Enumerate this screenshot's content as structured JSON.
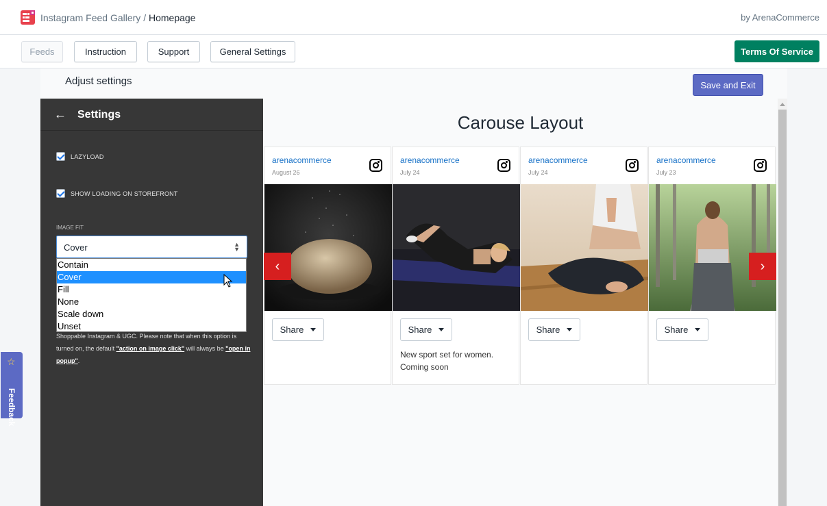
{
  "header": {
    "app_name": "Instagram Feed Gallery",
    "separator": "/",
    "page": "Homepage",
    "byline": "by ArenaCommerce"
  },
  "nav": {
    "feeds": "Feeds",
    "instruction": "Instruction",
    "support": "Support",
    "general_settings": "General Settings",
    "terms": "Terms Of Service"
  },
  "main": {
    "adjust_title": "Adjust settings",
    "save_exit": "Save and Exit"
  },
  "settings": {
    "back_icon": "arrow-left-icon",
    "title": "Settings",
    "lazyload": "LAZYLOAD",
    "lazyload_checked": true,
    "show_loading": "SHOW LOADING ON STOREFRONT",
    "show_loading_checked": true,
    "image_fit_label": "IMAGE FIT",
    "image_fit_value": "Cover",
    "image_fit_options": [
      "Contain",
      "Cover",
      "Fill",
      "None",
      "Scale down",
      "Unset"
    ],
    "help_prefix": "Shoppable Instagram & UGC. Please note that when this option is turned on, the default ",
    "help_link1": "\"action on image click\"",
    "help_mid": " will always be ",
    "help_link2": "\"open in popup\"",
    "help_suffix": "."
  },
  "preview": {
    "title": "Carouse Layout",
    "share_label": "Share",
    "posts": [
      {
        "user": "arenacommerce",
        "date": "August 26",
        "caption": ""
      },
      {
        "user": "arenacommerce",
        "date": "July 24",
        "caption": "New sport set for women. Coming soon"
      },
      {
        "user": "arenacommerce",
        "date": "July 24",
        "caption": ""
      },
      {
        "user": "arenacommerce",
        "date": "July 23",
        "caption": ""
      }
    ]
  },
  "feedback": {
    "label": "Feedback",
    "icon": "star-icon"
  },
  "colors": {
    "accent": "#5c6ac4",
    "primary_green": "#008060",
    "link_blue": "#1a73c8",
    "carousel_arrow": "#d61f1f",
    "panel_bg": "#373737"
  }
}
